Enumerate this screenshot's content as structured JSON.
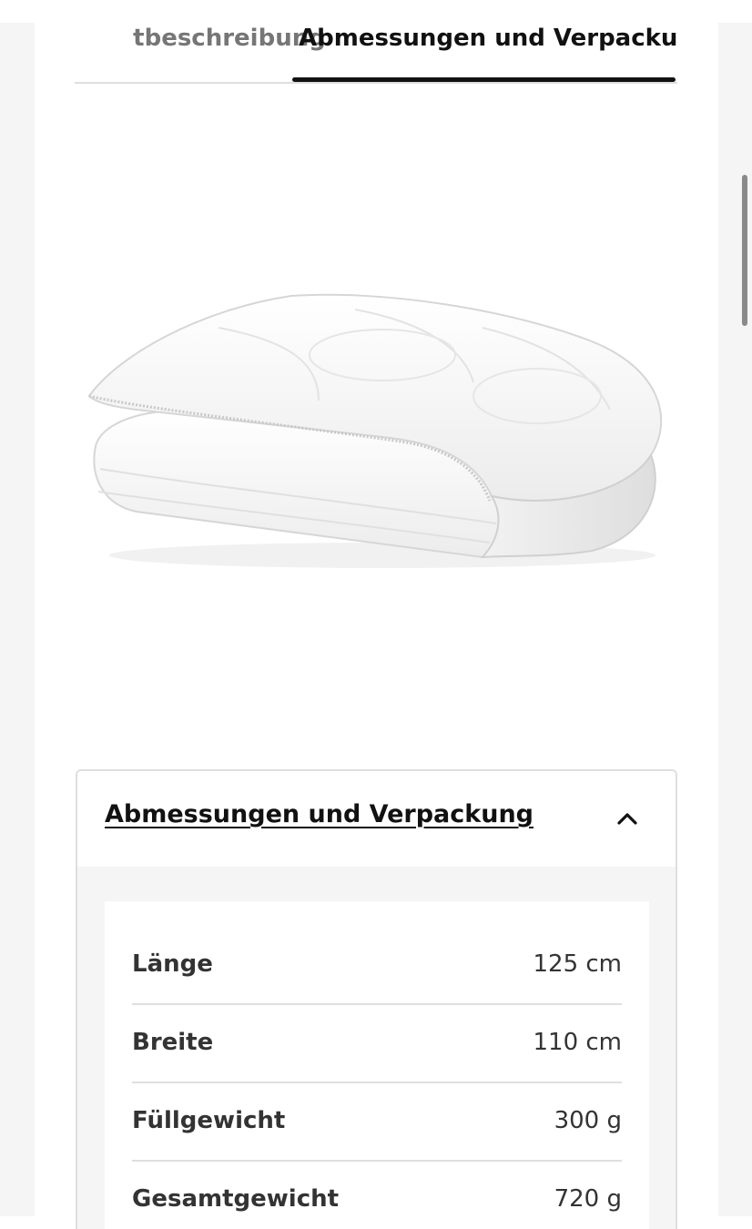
{
  "tabs": [
    {
      "label": "Produktbeschreibung",
      "visible_label": "tbeschreibung",
      "active": false
    },
    {
      "label": "Abmessungen und Verpackung",
      "active": true
    }
  ],
  "product": {
    "image": "folded white quilted baby duvet"
  },
  "accordion": {
    "title": "Abmessungen und Verpackung",
    "expanded": true,
    "icon": "chevron-up-icon"
  },
  "specs": [
    {
      "label": "Länge",
      "value": "125 cm"
    },
    {
      "label": "Breite",
      "value": "110 cm"
    },
    {
      "label": "Füllgewicht",
      "value": "300 g"
    },
    {
      "label": "Gesamtgewicht",
      "value": "720 g"
    }
  ],
  "colors": {
    "text": "#111111",
    "muted_text": "#767676",
    "divider": "#dfdfdf",
    "panel_bg": "#f5f5f5"
  }
}
